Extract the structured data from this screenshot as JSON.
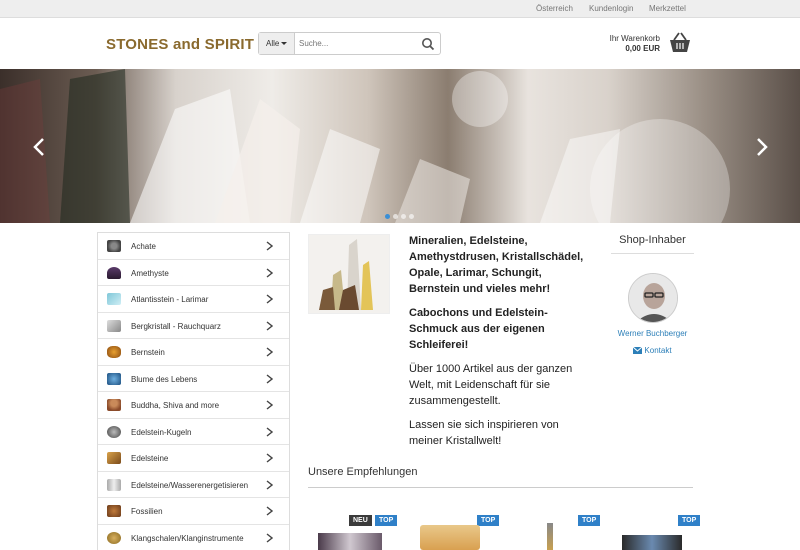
{
  "topbar": {
    "links": [
      "Österreich",
      "Kundenlogin",
      "Merkzettel"
    ]
  },
  "header": {
    "logo": "STONES and SPIRIT",
    "search": {
      "category": "Alle",
      "placeholder": "Suche..."
    },
    "cart": {
      "label": "Ihr Warenkorb",
      "amount": "0,00 EUR"
    }
  },
  "hero": {
    "slides": 4,
    "active_slide": 1
  },
  "categories": [
    "Achate",
    "Amethyste",
    "Atlantisstein - Larimar",
    "Bergkristall - Rauchquarz",
    "Bernstein",
    "Blume des Lebens",
    "Buddha, Shiva and more",
    "Edelstein-Kugeln",
    "Edelsteine",
    "Edelsteine/Wasserenergetisieren",
    "Fossilien",
    "Klangschalen/Klanginstrumente"
  ],
  "promo": {
    "heading": "Mineralien, Edelsteine, Amethystdrusen, Kristallschädel, Opale, Larimar, Schungit, Bernstein und vieles mehr!",
    "subheading": "Cabochons und Edelstein-Schmuck aus der eigenen Schleiferei!",
    "para1": "Über 1000 Artikel aus der ganzen Welt, mit Leidenschaft für sie zusammengestellt.",
    "para2": "Lassen sie sich inspirieren von meiner Kristallwelt!"
  },
  "owner": {
    "title": "Shop-Inhaber",
    "name": "Werner Buchberger",
    "contact": "Kontakt"
  },
  "recommendations": {
    "title": "Unsere Empfehlungen",
    "badges": {
      "neu": "NEU",
      "top": "TOP"
    }
  },
  "colors": {
    "brand": "#8a6a2e",
    "link": "#2c7fb8",
    "badge_top": "#2f80c8",
    "badge_new": "#3b3b3b"
  }
}
